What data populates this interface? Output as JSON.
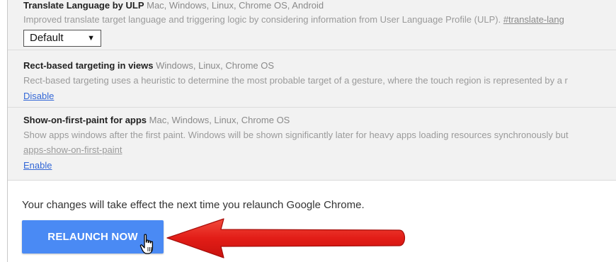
{
  "flags": [
    {
      "name": "Translate Language by ULP",
      "platforms": "Mac, Windows, Linux, Chrome OS, Android",
      "description": "Improved translate target language and triggering logic by considering information from User Language Profile (ULP).",
      "hash": "#translate-lang",
      "select_value": "Default"
    },
    {
      "name": "Rect-based targeting in views",
      "platforms": "Windows, Linux, Chrome OS",
      "description": "Rect-based targeting uses a heuristic to determine the most probable target of a gesture, where the touch region is represented by a r",
      "action_label": "Disable"
    },
    {
      "name": "Show-on-first-paint for apps",
      "platforms": "Mac, Windows, Linux, Chrome OS",
      "description": "Show apps windows after the first paint. Windows will be shown significantly later for heavy apps loading resources synchronously but",
      "hash": "apps-show-on-first-paint",
      "action_label": "Enable"
    }
  ],
  "relaunch": {
    "message": "Your changes will take effect the next time you relaunch Google Chrome.",
    "button_label": "RELAUNCH NOW"
  },
  "icons": {
    "cursor": "hand-pointer-cursor-icon",
    "select_arrow": "dropdown-arrow-icon",
    "annotation": "red-arrow-icon"
  },
  "colors": {
    "button": "#4a8af4",
    "link": "#3367d6",
    "annotation_arrow": "#e8201c",
    "panel_bg": "#f2f2f2"
  }
}
